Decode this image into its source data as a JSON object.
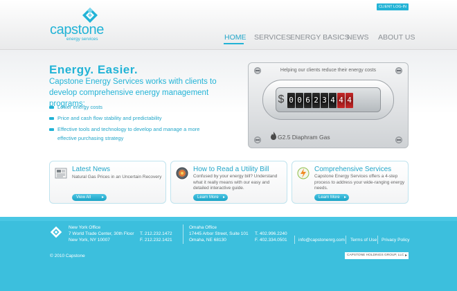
{
  "header": {
    "login": "CLIENT LOG-IN",
    "logo_word": "capstone",
    "logo_sub": "energy services",
    "nav": [
      "HOME",
      "SERVICES",
      "ENERGY BASICS",
      "NEWS",
      "ABOUT US"
    ],
    "active_nav": "HOME"
  },
  "hero": {
    "headline": "Energy. Easier.",
    "intro": "Capstone Energy Services works with clients to develop comprehensive energy management programs:",
    "bullets": [
      {
        "text": "Lower energy costs"
      },
      {
        "text": "Price and cash flow stability and predictability"
      },
      {
        "text": "Effective tools and technology to develop and manage a more",
        "cont": "effective purchasing strategy"
      }
    ],
    "meter": {
      "caption": "Helping our clients reduce their energy costs",
      "symbol": "$",
      "digits": [
        "0",
        "0",
        "6",
        "2",
        "3",
        "4",
        "4",
        "4"
      ],
      "label": "G2.5 Diaphram Gas"
    }
  },
  "cards": [
    {
      "title": "Latest News",
      "text": "Natural Gas Prices in an Uncertain Recovery",
      "button": "View All",
      "icon": "newspaper-icon"
    },
    {
      "title": "How to Read a Utility Bill",
      "text": "Confused by your energy bill? Understand what it really means with our easy and detailed interactive guide.",
      "button": "Learn More",
      "icon": "gauge-icon"
    },
    {
      "title": "Comprehensive Services",
      "text": "Capstone Energy Services offers a 4-step process to address your wide-ranging energy needs.",
      "button": "Learn More",
      "icon": "lightning-icon"
    }
  ],
  "footer": {
    "ny": {
      "name": "New York Office",
      "addr1": "7 World Trade Center, 30th Floor",
      "addr2": "New York, NY 10007",
      "tel": "T. 212.232.1472",
      "fax": "F. 212.232.1421"
    },
    "omaha": {
      "name": "Omaha Office",
      "addr1": "17445 Arbor Street, Suite 101",
      "addr2": "Omaha, NE 68130",
      "tel": "T. 402.996.2240",
      "fax": "F. 402.334.0501"
    },
    "email": "info@capstonenrg.com",
    "terms": "Terms of Use",
    "privacy": "Privacy Policy",
    "copyright": "© 2010 Capstone",
    "holdings": "CAPSTONE HOLDINGS GROUP, LLC"
  },
  "colors": {
    "brand": "#22b3d6",
    "footer": "#3cbfdd",
    "meter_red": "#c62828"
  }
}
